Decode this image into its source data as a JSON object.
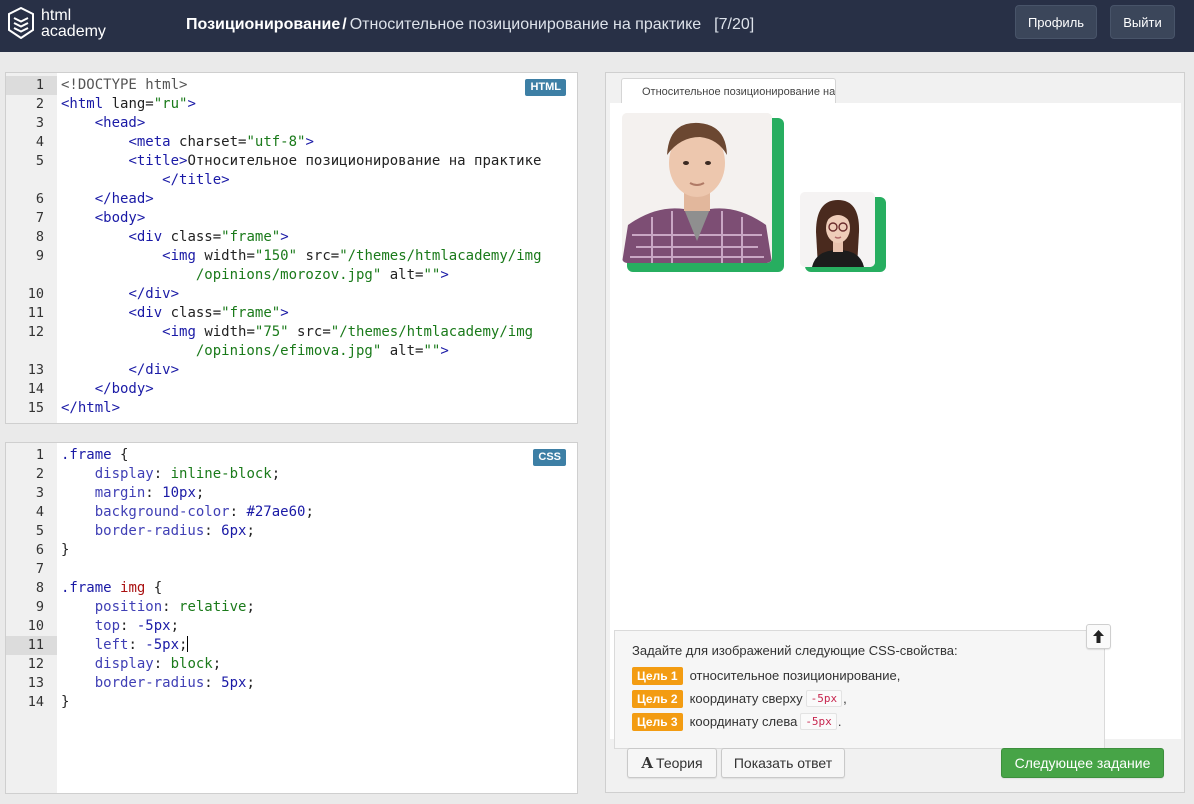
{
  "header": {
    "logo_line1": "html",
    "logo_line2": "academy",
    "section": "Позиционирование",
    "separator": "/",
    "task_title": "Относительное позиционирование на практике",
    "counter": "[7/20]",
    "profile_label": "Профиль",
    "logout_label": "Выйти"
  },
  "html_editor": {
    "badge": "HTML",
    "line_numbers": [
      "1",
      "2",
      "3",
      "4",
      "5",
      "",
      "6",
      "7",
      "8",
      "9",
      "",
      "10",
      "11",
      "12",
      "",
      "13",
      "14",
      "15"
    ],
    "active_line": "1"
  },
  "css_editor": {
    "badge": "CSS",
    "line_numbers": [
      "1",
      "2",
      "3",
      "4",
      "5",
      "6",
      "7",
      "8",
      "9",
      "10",
      "11",
      "12",
      "13",
      "14"
    ],
    "active_line": "11"
  },
  "preview": {
    "tab_label": "Относительное позиционирование на практике",
    "task_intro": "Задайте для изображений следующие CSS-свойства:",
    "goals": [
      {
        "badge": "Цель 1",
        "text": "относительное позиционирование,",
        "code": "",
        "suffix": ""
      },
      {
        "badge": "Цель 2",
        "text": "координату сверху",
        "code": "-5px",
        "suffix": ","
      },
      {
        "badge": "Цель 3",
        "text": "координату слева",
        "code": "-5px",
        "suffix": "."
      }
    ],
    "theory_icon": "A",
    "theory_label": "Теория",
    "show_answer_label": "Показать ответ",
    "next_label": "Следующее задание",
    "frame_color": "#27ae60",
    "goal_color": "#f39c12"
  },
  "icons": {
    "logo": "html-academy-logo-icon",
    "up": "arrow-up-icon"
  }
}
